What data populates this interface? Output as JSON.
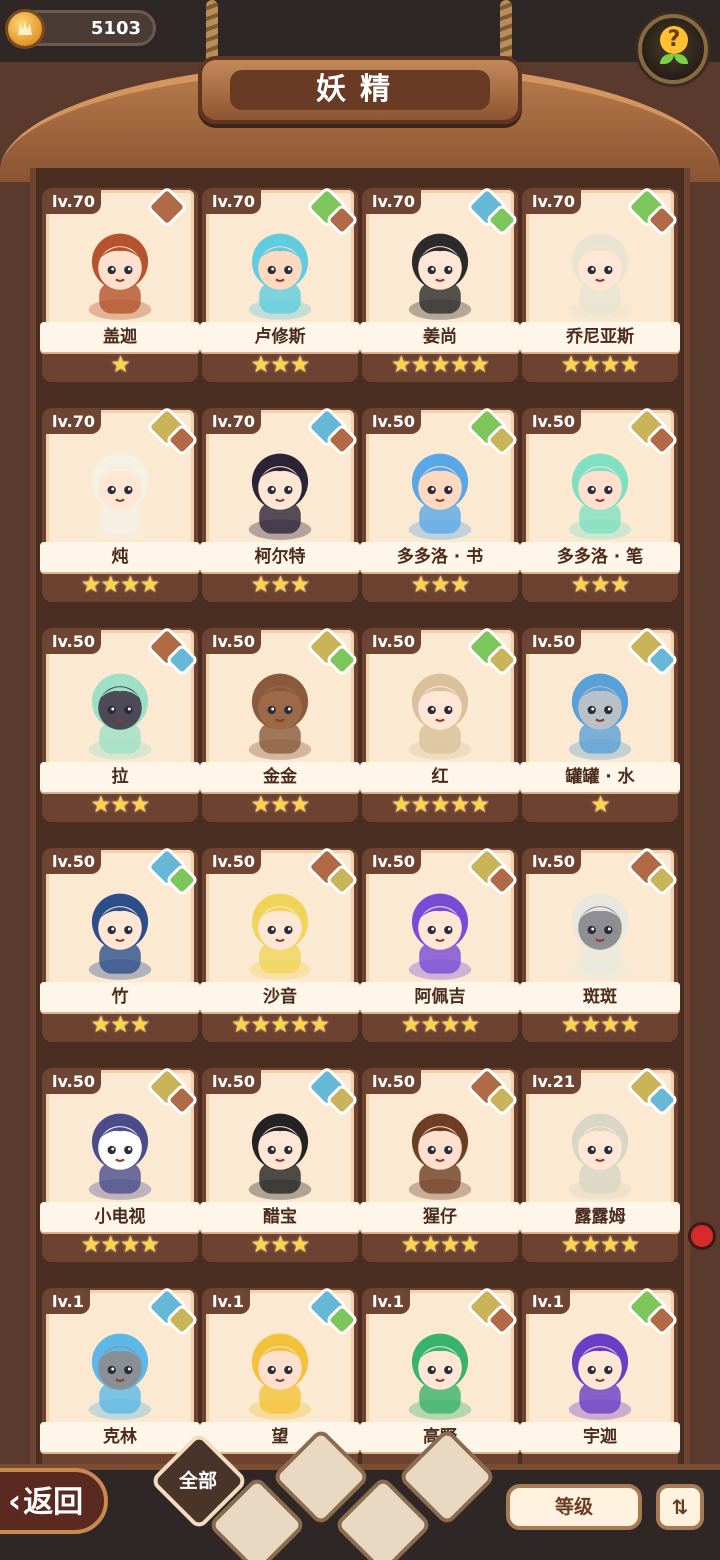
{
  "header": {
    "coins": "5103",
    "title": "妖精"
  },
  "cards": [
    {
      "level": "lv.70",
      "name": "盖迦",
      "stars": "★",
      "elements": [
        "earth"
      ],
      "hair": "#b4532d",
      "skin": "#ffe0cf"
    },
    {
      "level": "lv.70",
      "name": "卢修斯",
      "stars": "★★★",
      "elements": [
        "plant",
        "earth"
      ],
      "hair": "#5fcce0",
      "skin": "#ffd9bf"
    },
    {
      "level": "lv.70",
      "name": "姜尚",
      "stars": "★★★★★",
      "elements": [
        "water",
        "plant"
      ],
      "hair": "#2b2b2b",
      "skin": "#ffe6d5"
    },
    {
      "level": "lv.70",
      "name": "乔尼亚斯",
      "stars": "★★★★",
      "elements": [
        "plant",
        "earth"
      ],
      "hair": "#e9e4d2",
      "skin": "#ffe6d5"
    },
    {
      "level": "lv.70",
      "name": "炖",
      "stars": "★★★★",
      "elements": [
        "gold",
        "earth"
      ],
      "hair": "#f4f1e5",
      "skin": "#ffe6d5"
    },
    {
      "level": "lv.70",
      "name": "柯尔特",
      "stars": "★★★",
      "elements": [
        "water",
        "earth"
      ],
      "hair": "#2d2338",
      "skin": "#ffe6d5"
    },
    {
      "level": "lv.50",
      "name": "多多洛 · 书",
      "stars": "★★★",
      "elements": [
        "plant",
        "gold"
      ],
      "hair": "#5aa7e8",
      "skin": "#ffd9bf"
    },
    {
      "level": "lv.50",
      "name": "多多洛 · 笔",
      "stars": "★★★",
      "elements": [
        "gold",
        "earth"
      ],
      "hair": "#7fe0c2",
      "skin": "#ffe0cf"
    },
    {
      "level": "lv.50",
      "name": "拉",
      "stars": "★★★",
      "elements": [
        "earth",
        "water"
      ],
      "hair": "#9de0c6",
      "skin": "#4d4a57"
    },
    {
      "level": "lv.50",
      "name": "金金",
      "stars": "★★★",
      "elements": [
        "gold",
        "plant"
      ],
      "hair": "#8a5a3c",
      "skin": "#9c6a48"
    },
    {
      "level": "lv.50",
      "name": "红",
      "stars": "★★★★★",
      "elements": [
        "plant",
        "gold"
      ],
      "hair": "#d9c29b",
      "skin": "#ffe6d5"
    },
    {
      "level": "lv.50",
      "name": "罐罐 · 水",
      "stars": "★",
      "elements": [
        "gold",
        "water"
      ],
      "hair": "#5aa0d8",
      "skin": "#b8c0c8"
    },
    {
      "level": "lv.50",
      "name": "竹",
      "stars": "★★★",
      "elements": [
        "water",
        "plant"
      ],
      "hair": "#2c4f8c",
      "skin": "#ffe6d5"
    },
    {
      "level": "lv.50",
      "name": "沙音",
      "stars": "★★★★★",
      "elements": [
        "earth",
        "gold"
      ],
      "hair": "#f0d45a",
      "skin": "#ffe6d5"
    },
    {
      "level": "lv.50",
      "name": "阿佩吉",
      "stars": "★★★★",
      "elements": [
        "gold",
        "earth"
      ],
      "hair": "#7a4bd6",
      "skin": "#ffe6d5"
    },
    {
      "level": "lv.50",
      "name": "斑斑",
      "stars": "★★★★",
      "elements": [
        "earth",
        "gold"
      ],
      "hair": "#e8e8e0",
      "skin": "#8e8e93"
    },
    {
      "level": "lv.50",
      "name": "小电视",
      "stars": "★★★★",
      "elements": [
        "gold",
        "earth"
      ],
      "hair": "#4a4c8c",
      "skin": "#ffffff"
    },
    {
      "level": "lv.50",
      "name": "醋宝",
      "stars": "★★★",
      "elements": [
        "water",
        "gold"
      ],
      "hair": "#232323",
      "skin": "#ffe6d5"
    },
    {
      "level": "lv.50",
      "name": "猩仔",
      "stars": "★★★★",
      "elements": [
        "earth",
        "gold"
      ],
      "hair": "#6e3e24",
      "skin": "#ffe0cf"
    },
    {
      "level": "lv.21",
      "name": "露露姆",
      "stars": "★★★★",
      "elements": [
        "gold",
        "water"
      ],
      "hair": "#d8d6c4",
      "skin": "#ffe6d5"
    },
    {
      "level": "lv.1",
      "name": "克林",
      "stars": "",
      "elements": [
        "water",
        "gold"
      ],
      "hair": "#5cb8e6",
      "skin": "#8a8f96"
    },
    {
      "level": "lv.1",
      "name": "望",
      "stars": "",
      "elements": [
        "water",
        "plant"
      ],
      "hair": "#f2c23a",
      "skin": "#ffe0cf"
    },
    {
      "level": "lv.1",
      "name": "高野",
      "stars": "",
      "elements": [
        "gold",
        "earth"
      ],
      "hair": "#39b46c",
      "skin": "#ffe6d5"
    },
    {
      "level": "lv.1",
      "name": "宇迦",
      "stars": "",
      "elements": [
        "plant",
        "earth"
      ],
      "hair": "#6a3fc8",
      "skin": "#ffe6d5"
    }
  ],
  "footer": {
    "back_label": "返回",
    "tab_all": "全部",
    "sort_label": "等级",
    "order_icon": "sort-order-icon"
  },
  "colors": {
    "earth": "#b06b46",
    "water": "#66b8d6",
    "plant": "#7cc65c",
    "gold": "#c9b45a"
  }
}
